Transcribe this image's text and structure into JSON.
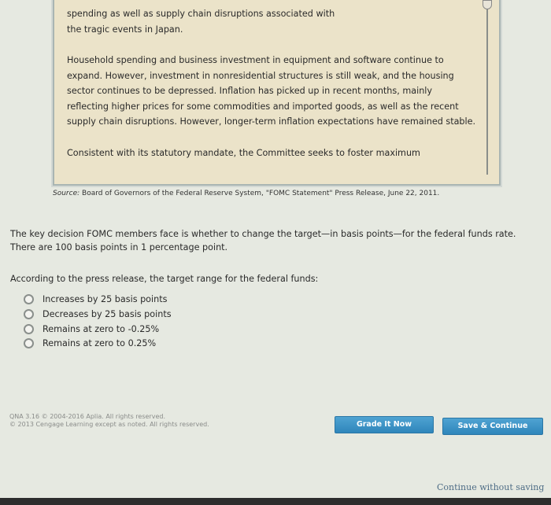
{
  "excerpt": {
    "paragraphs": [
      "spending as well as supply chain disruptions associated with the tragic events in Japan.",
      "Household spending and business investment in equipment and software continue to expand. However, investment in nonresidential structures is still weak, and the housing sector continues to be depressed. Inflation has picked up in recent months, mainly reflecting higher prices for some commodities and imported goods, as well as the recent supply chain disruptions. However, longer-term inflation expectations have remained stable.",
      "Consistent with its statutory mandate, the Committee seeks to foster maximum"
    ]
  },
  "source": {
    "label": "Source:",
    "text": "Board of Governors of the Federal Reserve System, \"FOMC Statement\" Press Release, June 22, 2011."
  },
  "intro": "The key decision FOMC members face is whether to change the target—in basis points—for the federal funds rate. There are 100 basis points in 1 percentage point.",
  "question": "According to the press release, the target range for the federal funds:",
  "options": [
    "Increases by 25 basis points",
    "Decreases by 25 basis points",
    "Remains at zero to -0.25%",
    "Remains at zero to 0.25%"
  ],
  "footer": {
    "line1": "QNA 3.16 © 2004-2016 Aplia. All rights reserved.",
    "line2": "© 2013 Cengage Learning except as noted. All rights reserved."
  },
  "buttons": {
    "grade": "Grade It Now",
    "save": "Save & Continue",
    "continue": "Continue without saving"
  }
}
